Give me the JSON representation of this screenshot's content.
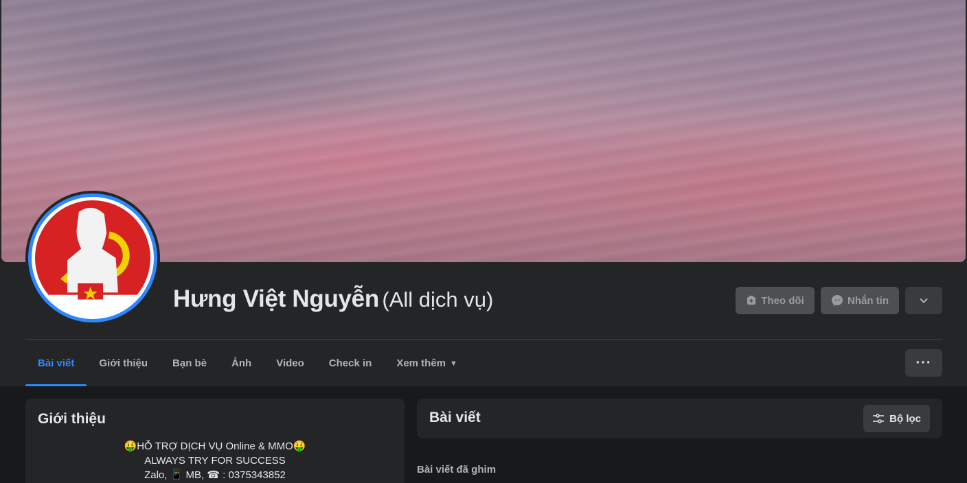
{
  "profile": {
    "name": "Hưng Việt Nguyễn",
    "alt_name": "(All dịch vụ)"
  },
  "actions": {
    "follow_label": "Theo dõi",
    "message_label": "Nhắn tin"
  },
  "tabs": [
    {
      "label": "Bài viết",
      "active": true
    },
    {
      "label": "Giới thiệu"
    },
    {
      "label": "Bạn bè"
    },
    {
      "label": "Ảnh"
    },
    {
      "label": "Video"
    },
    {
      "label": "Check in"
    },
    {
      "label": "Xem thêm"
    }
  ],
  "intro": {
    "title": "Giới thiệu",
    "bio_lines": [
      "🤑HỖ TRỢ DỊCH VỤ Online & MMO🤑",
      "ALWAYS TRY FOR SUCCESS",
      "Zalo, 📱 MB, ☎ : 0375343852"
    ]
  },
  "posts": {
    "title": "Bài viết",
    "filter_label": "Bộ lọc",
    "pinned_label": "Bài viết đã ghim"
  },
  "colors": {
    "accent": "#2d88ff",
    "surface": "#242526",
    "background": "#18191a"
  }
}
